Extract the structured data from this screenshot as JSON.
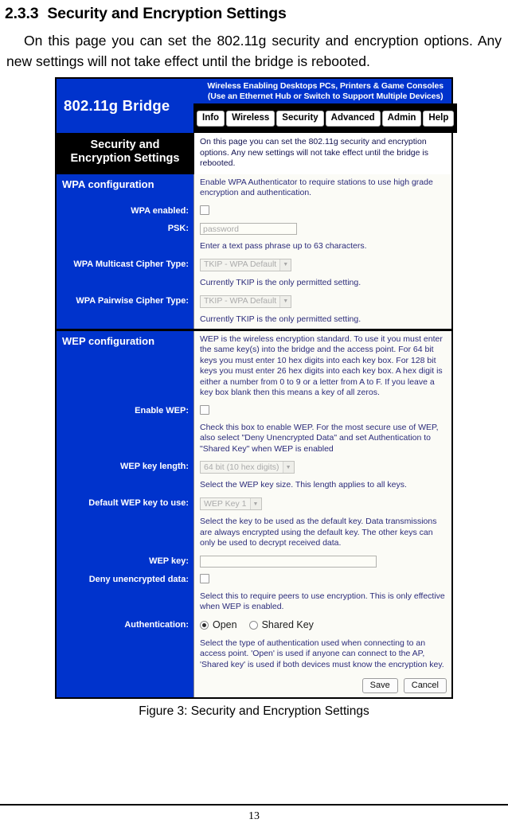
{
  "document": {
    "heading_number": "2.3.3",
    "heading_title": "Security and Encryption Settings",
    "paragraph": "On this page you can set the 802.11g security and encryption options. Any new settings will not take effect until the bridge is rebooted.",
    "figure_caption": "Figure 3: Security and Encryption Settings",
    "page_number": "13"
  },
  "ui": {
    "brand": "802.11g Bridge",
    "tagline_line1": "Wireless Enabling Desktops PCs, Printers & Game Consoles",
    "tagline_line2": "(Use an Ethernet Hub or Switch to Support Multiple Devices)",
    "tabs": [
      {
        "label": "Info"
      },
      {
        "label": "Wireless"
      },
      {
        "label": "Security"
      },
      {
        "label": "Advanced"
      },
      {
        "label": "Admin"
      },
      {
        "label": "Help"
      }
    ],
    "page_title": "Security and Encryption Settings",
    "page_description": "On this page you can set the 802.11g security and encryption options. Any new settings will not take effect until the bridge is rebooted.",
    "wpa": {
      "section_label": "WPA configuration",
      "section_description": "Enable WPA Authenticator to require stations to use high grade encryption and authentication.",
      "wpa_enabled_label": "WPA enabled:",
      "wpa_enabled_checked": false,
      "psk_label": "PSK:",
      "psk_value": "",
      "psk_placeholder": "password",
      "psk_help": "Enter a text pass phrase up to 63 characters.",
      "multicast_label": "WPA Multicast Cipher Type:",
      "multicast_value": "TKIP - WPA Default",
      "multicast_help": "Currently TKIP is the only permitted setting.",
      "pairwise_label": "WPA Pairwise Cipher Type:",
      "pairwise_value": "TKIP - WPA Default",
      "pairwise_help": "Currently TKIP is the only permitted setting."
    },
    "wep": {
      "section_label": "WEP configuration",
      "section_description": "WEP is the wireless encryption standard. To use it you must enter the same key(s) into the bridge and the access point. For 64 bit keys you must enter 10 hex digits into each key box. For 128 bit keys you must enter 26 hex digits into each key box. A hex digit is either a number from 0 to 9 or a letter from A to F. If you leave a key box blank then this means a key of all zeros.",
      "enable_wep_label": "Enable WEP:",
      "enable_wep_checked": false,
      "enable_wep_help": "Check this box to enable WEP. For the most secure use of WEP, also select \"Deny Unencrypted Data\" and set Authentication to \"Shared Key\" when WEP is enabled",
      "key_length_label": "WEP key length:",
      "key_length_value": "64 bit (10 hex digits)",
      "key_length_help": "Select the WEP key size. This length applies to all keys.",
      "default_key_label": "Default WEP key to use:",
      "default_key_value": "WEP Key 1",
      "default_key_help": "Select the key to be used as the default key. Data transmissions are always encrypted using the default key. The other keys can only be used to decrypt received data.",
      "wep_key_label": "WEP key:",
      "wep_key_value": "",
      "deny_unencrypted_label": "Deny unencrypted data:",
      "deny_unencrypted_checked": false,
      "deny_unencrypted_help": "Select this to require peers to use encryption. This is only effective when WEP is enabled.",
      "authentication_label": "Authentication:",
      "auth_option_open": "Open",
      "auth_option_shared": "Shared Key",
      "auth_selected": "Open",
      "authentication_help": "Select the type of authentication used when connecting to an access point. 'Open' is used if anyone can connect to the AP, 'Shared key' is used if both devices must know the encryption key."
    },
    "buttons": {
      "save": "Save",
      "cancel": "Cancel"
    },
    "colors": {
      "brand_blue": "#0033CC",
      "title_black": "#000000",
      "panel_bg": "#FBFBF6",
      "help_text": "#2B2B7A"
    }
  }
}
